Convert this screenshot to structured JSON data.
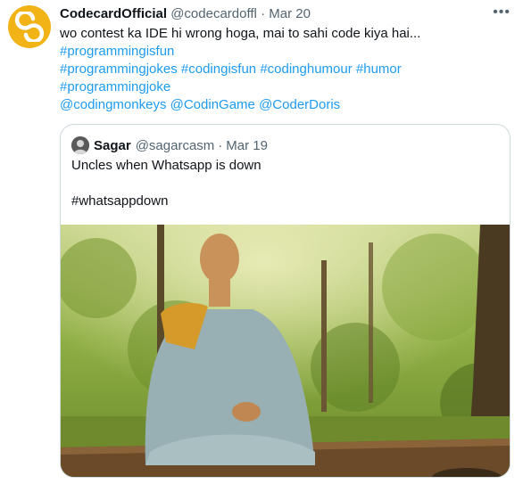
{
  "tweet": {
    "display_name": "CodecardOfficial",
    "handle": "@codecardoffl",
    "separator": "·",
    "date": "Mar 20",
    "more_icon": "more-horizontal-icon",
    "text": "wo contest ka IDE hi wrong hoga, mai to sahi code kiya hai...",
    "hashtags_line1": [
      "#programmingisfun"
    ],
    "hashtags_line2": [
      "#programmingjokes",
      "#codingisfun",
      "#codinghumour",
      "#humor"
    ],
    "hashtags_line3": [
      "#programmingjoke"
    ],
    "mentions": [
      "@codingmonkeys",
      "@CodinGame",
      "@CoderDoris"
    ]
  },
  "quote": {
    "display_name": "Sagar",
    "handle": "@sagarcasm",
    "separator": "·",
    "date": "Mar 19",
    "text_line1": "Uncles when Whatsapp is down",
    "text_line2": "",
    "text_line3": "#whatsappdown"
  },
  "colors": {
    "link": "#1d9bf0",
    "muted": "#536471",
    "border": "#cfd9de",
    "avatar_bg": "#f2b316"
  }
}
